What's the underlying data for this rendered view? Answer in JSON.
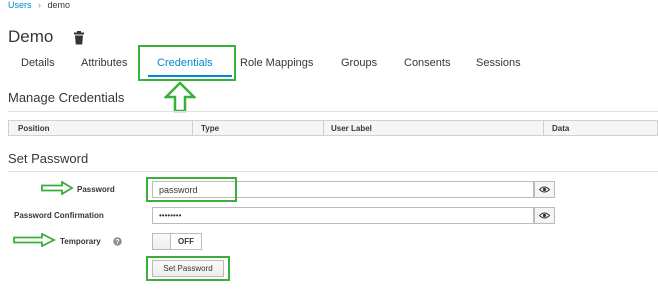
{
  "breadcrumb": {
    "users": "Users",
    "separator": "›",
    "current": "demo"
  },
  "page_title": "Demo",
  "tabs": [
    {
      "label": "Details"
    },
    {
      "label": "Attributes"
    },
    {
      "label": "Credentials",
      "active": true
    },
    {
      "label": "Role Mappings"
    },
    {
      "label": "Groups"
    },
    {
      "label": "Consents"
    },
    {
      "label": "Sessions"
    }
  ],
  "manage_credentials": {
    "title": "Manage Credentials",
    "columns": [
      "Position",
      "Type",
      "User Label",
      "Data"
    ]
  },
  "set_password": {
    "title": "Set Password",
    "password_label": "Password",
    "password_value": "password",
    "confirmation_label": "Password Confirmation",
    "confirmation_value": "••••••••",
    "temporary_label": "Temporary",
    "temporary_state": "OFF",
    "button_label": "Set Password"
  },
  "colors": {
    "accent": "#0088ce",
    "highlight": "#3aaf3a",
    "header_bg": "#f5f5f5"
  },
  "icons": [
    "trash-icon",
    "eye-icon",
    "help-icon",
    "arrow-up-icon",
    "arrow-right-icon"
  ]
}
